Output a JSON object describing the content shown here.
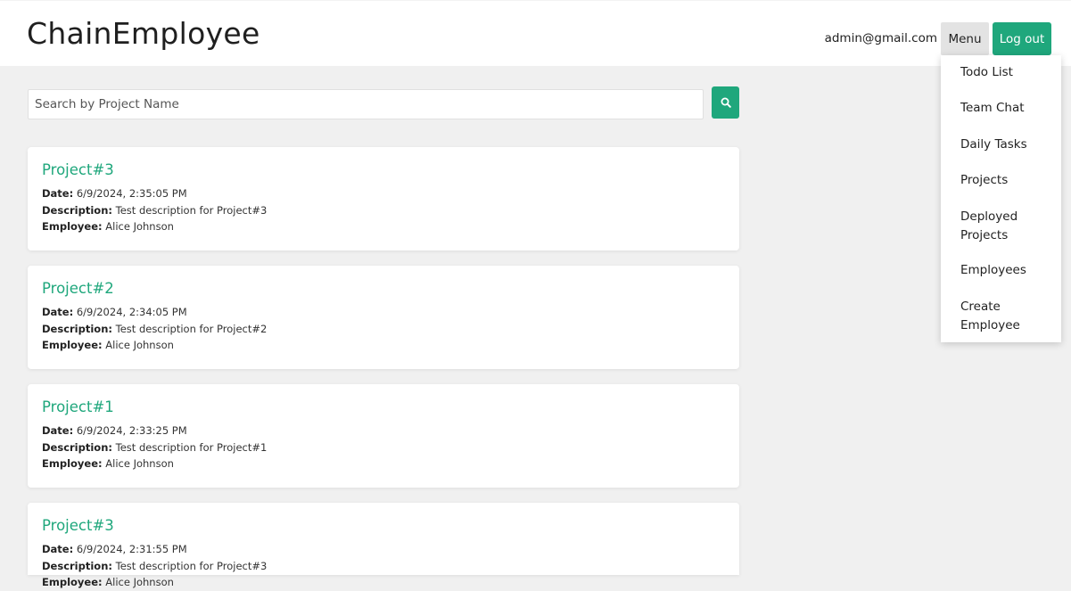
{
  "app": {
    "brand": "ChainEmployee"
  },
  "header": {
    "user_email": "admin@gmail.com",
    "menu_label": "Menu",
    "logout_label": "Log out"
  },
  "search": {
    "placeholder": "Search by Project Name",
    "value": "",
    "button_icon": "search-icon"
  },
  "projects": [
    {
      "title": "Project#3",
      "date_label": "Date:",
      "date": "6/9/2024, 2:35:05 PM",
      "description_label": "Description:",
      "description": "Test description for Project#3",
      "employee_label": "Employee:",
      "employee": "Alice Johnson"
    },
    {
      "title": "Project#2",
      "date_label": "Date:",
      "date": "6/9/2024, 2:34:05 PM",
      "description_label": "Description:",
      "description": "Test description for Project#2",
      "employee_label": "Employee:",
      "employee": "Alice Johnson"
    },
    {
      "title": "Project#1",
      "date_label": "Date:",
      "date": "6/9/2024, 2:33:25 PM",
      "description_label": "Description:",
      "description": "Test description for Project#1",
      "employee_label": "Employee:",
      "employee": "Alice Johnson"
    },
    {
      "title": "Project#3",
      "date_label": "Date:",
      "date": "6/9/2024, 2:31:55 PM",
      "description_label": "Description:",
      "description": "Test description for Project#3",
      "employee_label": "Employee:",
      "employee": "Alice Johnson"
    }
  ],
  "dropdown": {
    "items": [
      {
        "label": "Todo List"
      },
      {
        "label": "Team Chat"
      },
      {
        "label": "Daily Tasks"
      },
      {
        "label": "Projects"
      },
      {
        "label": "Deployed Projects"
      },
      {
        "label": "Employees"
      },
      {
        "label": "Create Employee"
      }
    ]
  },
  "colors": {
    "accent": "#1fa77c",
    "background": "#f0f0f0",
    "card": "#ffffff"
  }
}
